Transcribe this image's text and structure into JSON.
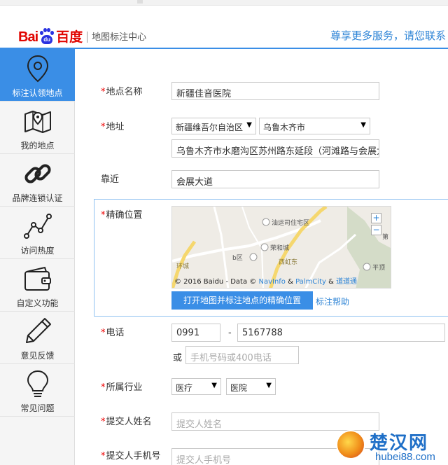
{
  "header": {
    "logo_text_bai": "Bai",
    "logo_text_du": "du",
    "logo_text_cn": "百度",
    "subtitle": "地图标注中心",
    "promo": "尊享更多服务，请您联系"
  },
  "sidebar": {
    "items": [
      {
        "label": "标注认领地点",
        "icon": "location-pin-icon",
        "active": true
      },
      {
        "label": "我的地点",
        "icon": "folded-map-icon",
        "active": false
      },
      {
        "label": "品牌连锁认证",
        "icon": "chain-link-icon",
        "active": false
      },
      {
        "label": "访问热度",
        "icon": "line-trend-icon",
        "active": false
      },
      {
        "label": "自定义功能",
        "icon": "wallet-icon",
        "active": false
      },
      {
        "label": "意见反馈",
        "icon": "pencil-icon",
        "active": false
      },
      {
        "label": "常见问题",
        "icon": "lightbulb-icon",
        "active": false
      }
    ]
  },
  "form": {
    "name": {
      "required_mark": "*",
      "label": "地点名称",
      "value": "新疆佳音医院"
    },
    "address": {
      "required_mark": "*",
      "label": "地址",
      "province": "新疆维吾尔自治区",
      "city": "乌鲁木齐市",
      "detail": "乌鲁木齐市水磨沟区苏州路东延段（河滩路与会展大道"
    },
    "near": {
      "label": "靠近",
      "value": "会展大道"
    },
    "location": {
      "required_mark": "*",
      "label": "精确位置",
      "map_labels": {
        "poi1": "油运司住宅区",
        "poi2": "荣和城",
        "poi3": "b区",
        "poi4": "平顶",
        "road1": "环城",
        "road2": "西虹东",
        "edge": "第"
      },
      "copyright_prefix": "© 2016 Baidu - Data © ",
      "copyright_navinfo": "NavInfo",
      "copyright_amp": " & ",
      "copyright_palmcity": "PalmCity",
      "copyright_amp2": " & ",
      "copyright_last": "道道通",
      "zoom_in": "+",
      "zoom_out": "−",
      "open_map_button": "打开地图并标注地点的精确位置",
      "help_link": "标注帮助"
    },
    "phone": {
      "required_mark": "*",
      "label": "电话",
      "area_code": "0991",
      "dash": "-",
      "number": "5167788",
      "or_label": "或",
      "mobile_placeholder": "手机号码或400电话"
    },
    "industry": {
      "required_mark": "*",
      "label": "所属行业",
      "category": "医疗",
      "subcategory": "医院"
    },
    "submitter_name": {
      "required_mark": "*",
      "label": "提交人姓名",
      "placeholder": "提交人姓名"
    },
    "submitter_phone": {
      "required_mark": "*",
      "label": "提交人手机号",
      "placeholder": "提交人手机号"
    }
  },
  "watermark": {
    "title": "楚汉网",
    "url": "hubei88.com"
  },
  "colors": {
    "accent": "#3a8ee6",
    "brand_red": "#e10601",
    "brand_blue": "#2932e1",
    "link": "#2e84d6",
    "required": "#ee0000"
  }
}
